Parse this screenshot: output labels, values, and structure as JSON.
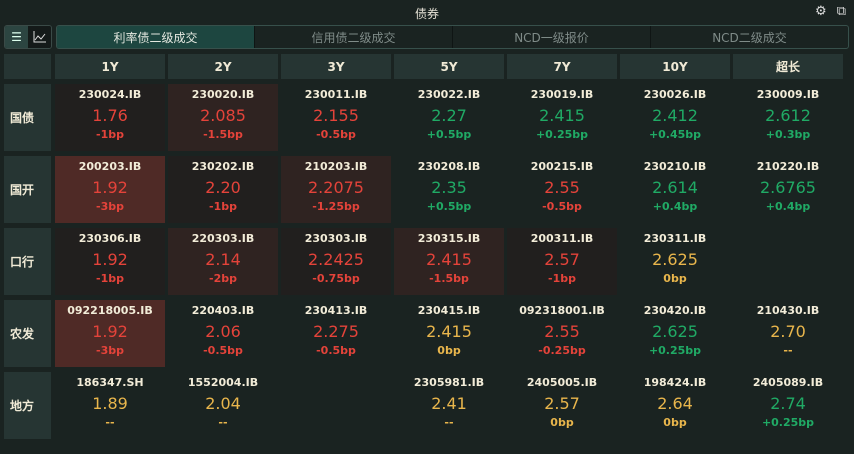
{
  "title": "债券",
  "icons": {
    "settings": "gear-icon",
    "popout": "external-link-icon",
    "list": "list-icon",
    "chart": "line-chart-icon"
  },
  "colors": {
    "red": "#e4433a",
    "green": "#20aa65",
    "yellow": "#e9b64c"
  },
  "tabs": [
    {
      "label": "利率债二级成交",
      "active": true
    },
    {
      "label": "信用债二级成交"
    },
    {
      "label": "NCD一级报价"
    },
    {
      "label": "NCD二级成交"
    }
  ],
  "columns": [
    "1Y",
    "2Y",
    "3Y",
    "5Y",
    "7Y",
    "10Y",
    "超长"
  ],
  "rows": [
    {
      "label": "国债",
      "cells": [
        {
          "code": "230024.IB",
          "yield": "1.76",
          "change": "-1bp",
          "color": "red",
          "bg": "dark"
        },
        {
          "code": "230020.IB",
          "yield": "2.085",
          "change": "-1.5bp",
          "color": "red",
          "bg": "light"
        },
        {
          "code": "230011.IB",
          "yield": "2.155",
          "change": "-0.5bp",
          "color": "red",
          "bg": ""
        },
        {
          "code": "230022.IB",
          "yield": "2.27",
          "change": "+0.5bp",
          "color": "green",
          "bg": ""
        },
        {
          "code": "230019.IB",
          "yield": "2.415",
          "change": "+0.25bp",
          "color": "green",
          "bg": ""
        },
        {
          "code": "230026.IB",
          "yield": "2.412",
          "change": "+0.45bp",
          "color": "green",
          "bg": ""
        },
        {
          "code": "230009.IB",
          "yield": "2.612",
          "change": "+0.3bp",
          "color": "green",
          "bg": ""
        }
      ]
    },
    {
      "label": "国开",
      "cells": [
        {
          "code": "200203.IB",
          "yield": "1.92",
          "change": "-3bp",
          "color": "red",
          "bg": "strong"
        },
        {
          "code": "230202.IB",
          "yield": "2.20",
          "change": "-1bp",
          "color": "red",
          "bg": "dark"
        },
        {
          "code": "210203.IB",
          "yield": "2.2075",
          "change": "-1.25bp",
          "color": "red",
          "bg": "light"
        },
        {
          "code": "230208.IB",
          "yield": "2.35",
          "change": "+0.5bp",
          "color": "green",
          "bg": ""
        },
        {
          "code": "200215.IB",
          "yield": "2.55",
          "change": "-0.5bp",
          "color": "red",
          "bg": ""
        },
        {
          "code": "230210.IB",
          "yield": "2.614",
          "change": "+0.4bp",
          "color": "green",
          "bg": ""
        },
        {
          "code": "210220.IB",
          "yield": "2.6765",
          "change": "+0.4bp",
          "color": "green",
          "bg": ""
        }
      ]
    },
    {
      "label": "口行",
      "cells": [
        {
          "code": "230306.IB",
          "yield": "1.92",
          "change": "-1bp",
          "color": "red",
          "bg": "dark"
        },
        {
          "code": "220303.IB",
          "yield": "2.14",
          "change": "-2bp",
          "color": "red",
          "bg": "light"
        },
        {
          "code": "230303.IB",
          "yield": "2.2425",
          "change": "-0.75bp",
          "color": "red",
          "bg": "dark"
        },
        {
          "code": "230315.IB",
          "yield": "2.415",
          "change": "-1.5bp",
          "color": "red",
          "bg": "light"
        },
        {
          "code": "200311.IB",
          "yield": "2.57",
          "change": "-1bp",
          "color": "red",
          "bg": "dark"
        },
        {
          "code": "230311.IB",
          "yield": "2.625",
          "change": "0bp",
          "color": "yellow",
          "bg": ""
        },
        null
      ]
    },
    {
      "label": "农发",
      "cells": [
        {
          "code": "092218005.IB",
          "yield": "1.92",
          "change": "-3bp",
          "color": "red",
          "bg": "strong"
        },
        {
          "code": "220403.IB",
          "yield": "2.06",
          "change": "-0.5bp",
          "color": "red",
          "bg": ""
        },
        {
          "code": "230413.IB",
          "yield": "2.275",
          "change": "-0.5bp",
          "color": "red",
          "bg": ""
        },
        {
          "code": "230415.IB",
          "yield": "2.415",
          "change": "0bp",
          "color": "yellow",
          "bg": ""
        },
        {
          "code": "092318001.IB",
          "yield": "2.55",
          "change": "-0.25bp",
          "color": "red",
          "bg": ""
        },
        {
          "code": "230420.IB",
          "yield": "2.625",
          "change": "+0.25bp",
          "color": "green",
          "bg": ""
        },
        {
          "code": "210430.IB",
          "yield": "2.70",
          "change": "--",
          "color": "yellow",
          "bg": ""
        }
      ]
    },
    {
      "label": "地方",
      "cells": [
        {
          "code": "186347.SH",
          "yield": "1.89",
          "change": "--",
          "color": "yellow",
          "bg": ""
        },
        {
          "code": "1552004.IB",
          "yield": "2.04",
          "change": "--",
          "color": "yellow",
          "bg": ""
        },
        null,
        {
          "code": "2305981.IB",
          "yield": "2.41",
          "change": "--",
          "color": "yellow",
          "bg": ""
        },
        {
          "code": "2405005.IB",
          "yield": "2.57",
          "change": "0bp",
          "color": "yellow",
          "bg": ""
        },
        {
          "code": "198424.IB",
          "yield": "2.64",
          "change": "0bp",
          "color": "yellow",
          "bg": ""
        },
        {
          "code": "2405089.IB",
          "yield": "2.74",
          "change": "+0.25bp",
          "color": "green",
          "bg": ""
        }
      ]
    }
  ]
}
